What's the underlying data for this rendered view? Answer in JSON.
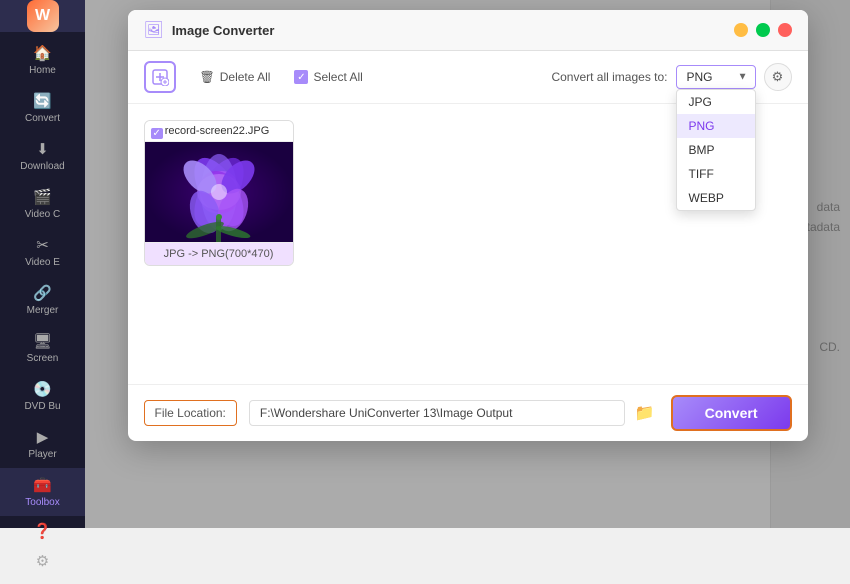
{
  "sidebar": {
    "logo_char": "W",
    "items": [
      {
        "id": "home",
        "label": "Home",
        "icon": "🏠"
      },
      {
        "id": "convert",
        "label": "Convert",
        "icon": "🔄"
      },
      {
        "id": "download",
        "label": "Download",
        "icon": "⬇"
      },
      {
        "id": "video-c",
        "label": "Video C",
        "icon": "🎬"
      },
      {
        "id": "video-e",
        "label": "Video E",
        "icon": "✂"
      },
      {
        "id": "merger",
        "label": "Merger",
        "icon": "🔗"
      },
      {
        "id": "screen",
        "label": "Screen",
        "icon": "🖥"
      },
      {
        "id": "dvd",
        "label": "DVD Bu",
        "icon": "💿"
      },
      {
        "id": "player",
        "label": "Player",
        "icon": "▶"
      },
      {
        "id": "toolbox",
        "label": "Toolbox",
        "icon": "🧰",
        "active": true
      }
    ],
    "bottom_items": [
      {
        "id": "help",
        "label": "Help",
        "icon": "?"
      },
      {
        "id": "settings",
        "label": "Settings",
        "icon": "⚙"
      }
    ]
  },
  "modal": {
    "title": "Image Converter",
    "toolbar": {
      "delete_all": "Delete All",
      "select_all": "Select All",
      "convert_all_label": "Convert all images to:",
      "format_options": [
        "JPG",
        "PNG",
        "BMP",
        "TIFF",
        "WEBP"
      ],
      "selected_format": "PNG",
      "format_dropdown_visible": true
    },
    "image": {
      "filename": "record-screen22.JPG",
      "checkbox_checked": true,
      "label": "JPG -> PNG(700*470)"
    },
    "footer": {
      "file_location_label": "File Location:",
      "file_path": "F:\\Wondershare UniConverter 13\\Image Output",
      "convert_btn": "Convert"
    }
  },
  "background": {
    "right_text1": "data",
    "right_text2": "etadata",
    "right_text3": "CD."
  }
}
